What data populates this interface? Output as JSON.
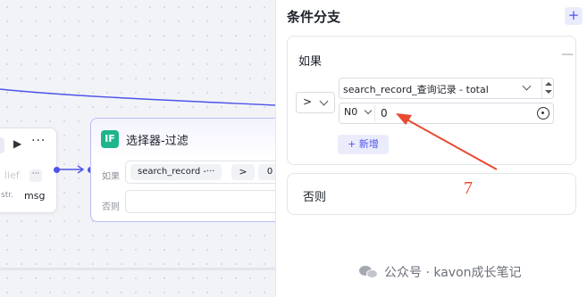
{
  "canvas": {
    "node_a": {
      "faded_label": "lief",
      "mini_more": "···",
      "type_tag": "str.",
      "output_name": "msg"
    },
    "node_b": {
      "icon_text": "IF",
      "title": "选择器-过滤",
      "if_label": "如果",
      "else_label": "否则",
      "condition_var": "search_record -···",
      "condition_op": ">",
      "condition_value": "0"
    }
  },
  "panel": {
    "title": "条件分支",
    "add_symbol": "+",
    "if_section": {
      "heading": "如果",
      "collapse_symbol": "—",
      "operator": ">",
      "variable": "search_record_查询记录 - total",
      "value_type": "N0",
      "value": "0",
      "add_condition_label": "+ 新增"
    },
    "else_section": {
      "heading": "否则"
    }
  },
  "annotation": {
    "number": "7",
    "color": "#e8492f"
  },
  "watermark": {
    "text": "公众号 · kavon成长笔记"
  },
  "colors": {
    "accent": "#4d53e8",
    "if_icon": "#1eb58c"
  }
}
